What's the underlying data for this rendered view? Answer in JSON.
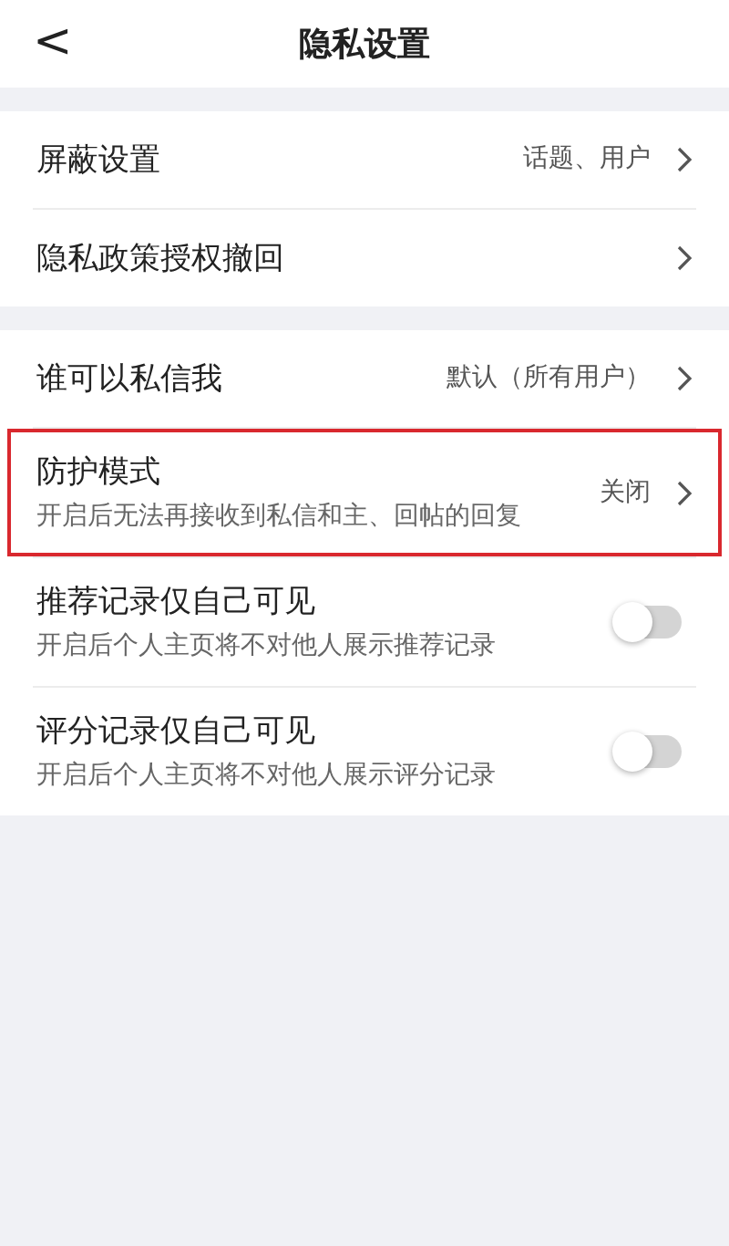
{
  "header": {
    "back": "<",
    "title": "隐私设置"
  },
  "groups": [
    {
      "items": [
        {
          "kind": "link",
          "label": "屏蔽设置",
          "value": "话题、用户",
          "highlighted": false
        },
        {
          "kind": "link",
          "label": "隐私政策授权撤回",
          "highlighted": false
        }
      ]
    },
    {
      "items": [
        {
          "kind": "link",
          "label": "谁可以私信我",
          "value": "默认（所有用户）",
          "highlighted": false
        },
        {
          "kind": "link",
          "label": "防护模式",
          "description": "开启后无法再接收到私信和主、回帖的回复",
          "value": "关闭",
          "highlighted": true
        },
        {
          "kind": "toggle",
          "label": "推荐记录仅自己可见",
          "description": "开启后个人主页将不对他人展示推荐记录",
          "on": false,
          "highlighted": false
        },
        {
          "kind": "toggle",
          "label": "评分记录仅自己可见",
          "description": "开启后个人主页将不对他人展示评分记录",
          "on": false,
          "highlighted": false
        }
      ]
    }
  ]
}
